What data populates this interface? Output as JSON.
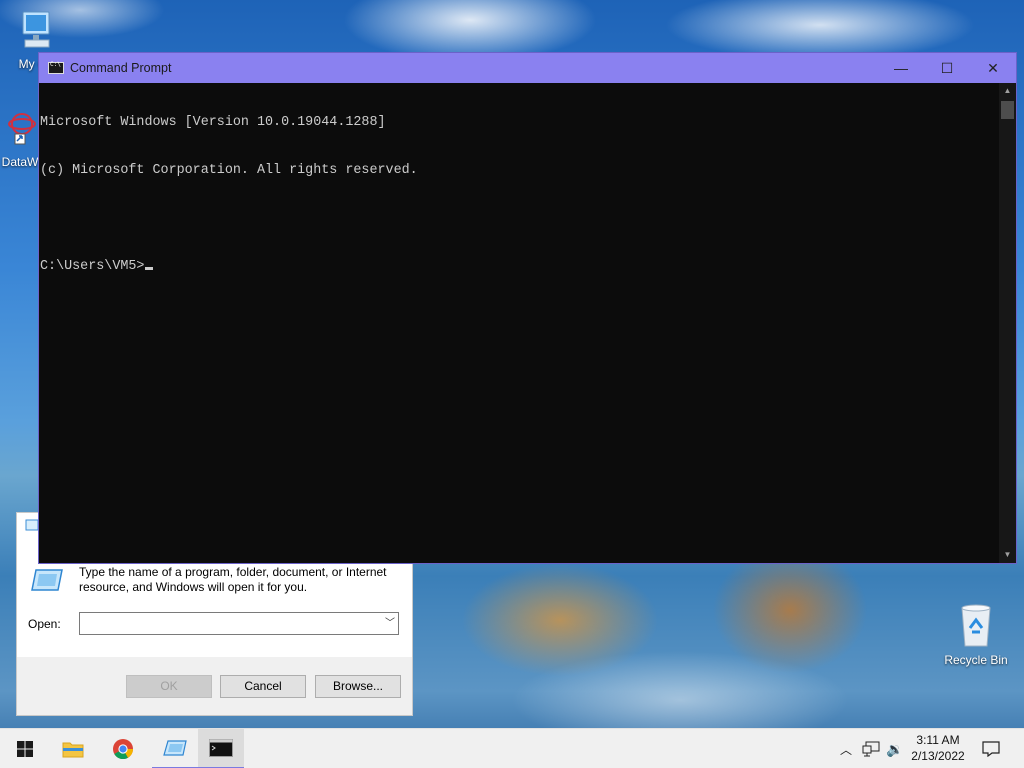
{
  "desktop": {
    "icons": [
      {
        "label": "My Co",
        "icon": "monitor-icon"
      },
      {
        "label": "DataW",
        "icon": "dataw-icon"
      },
      {
        "label": "Recycle Bin",
        "icon": "recycle-bin-icon"
      }
    ]
  },
  "cmd": {
    "title": "Command Prompt",
    "lines": [
      "Microsoft Windows [Version 10.0.19044.1288]",
      "(c) Microsoft Corporation. All rights reserved."
    ],
    "prompt": "C:\\Users\\VM5>",
    "controls": {
      "minimize": "—",
      "maximize": "☐",
      "close": "✕"
    }
  },
  "run_dialog": {
    "description": "Type the name of a program, folder, document, or Internet resource, and Windows will open it for you.",
    "open_label": "Open:",
    "open_value": "",
    "ok_label": "OK",
    "cancel_label": "Cancel",
    "browse_label": "Browse..."
  },
  "taskbar": {
    "items": [
      "start-icon",
      "file-explorer-icon",
      "chrome-icon",
      "run-icon",
      "cmd-icon"
    ],
    "clock_time": "3:11 AM",
    "clock_date": "2/13/2022"
  },
  "colors": {
    "cmd_titlebar": "#8a81f0",
    "cmd_background": "#0c0c0c",
    "cmd_text": "#cccccc",
    "taskbar": "#f0f0f0"
  }
}
